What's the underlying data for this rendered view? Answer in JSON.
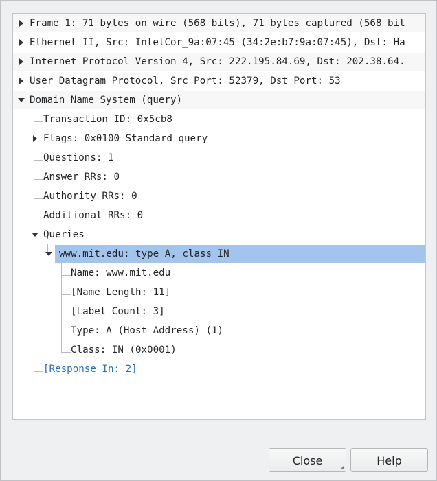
{
  "tree": {
    "frame": "Frame 1: 71 bytes on wire (568 bits), 71 bytes captured (568 bit",
    "ethernet": "Ethernet II, Src: IntelCor_9a:07:45 (34:2e:b7:9a:07:45), Dst: Ha",
    "ip": "Internet Protocol Version 4, Src: 222.195.84.69, Dst: 202.38.64.",
    "udp": "User Datagram Protocol, Src Port: 52379, Dst Port: 53",
    "dns": "Domain Name System (query)",
    "transaction_id": "Transaction ID: 0x5cb8",
    "flags": "Flags: 0x0100 Standard query",
    "questions": "Questions: 1",
    "answer_rrs": "Answer RRs: 0",
    "authority_rrs": "Authority RRs: 0",
    "additional_rrs": "Additional RRs: 0",
    "queries": "Queries",
    "query": "www.mit.edu: type A, class IN",
    "q_name": "Name: www.mit.edu",
    "q_name_length": "[Name Length: 11]",
    "q_label_count": "[Label Count: 3]",
    "q_type": "Type: A (Host Address) (1)",
    "q_class": "Class: IN (0x0001)",
    "response_in": "[Response In: 2]"
  },
  "buttons": {
    "close": "Close",
    "help": "Help"
  },
  "colors": {
    "selection": "#a3c4ec",
    "link": "#2a72b5"
  }
}
